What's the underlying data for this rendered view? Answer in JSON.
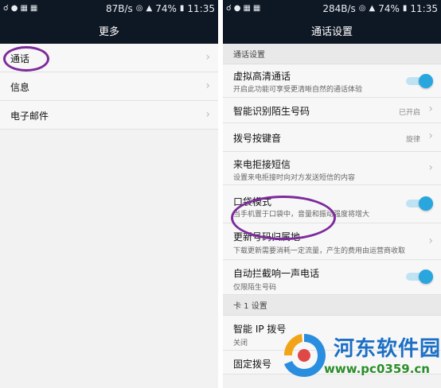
{
  "left": {
    "status": {
      "speed": "87B/s",
      "signal_label": "3G",
      "battery": "74%",
      "time": "11:35"
    },
    "title": "更多",
    "items": [
      {
        "label": "通话"
      },
      {
        "label": "信息"
      },
      {
        "label": "电子邮件"
      }
    ]
  },
  "right": {
    "status": {
      "speed": "284B/s",
      "signal_label": "3G",
      "battery": "74%",
      "time": "11:35"
    },
    "title": "通话设置",
    "sections": {
      "call": "通话设置",
      "card1": "卡 1 设置"
    },
    "rows": {
      "hd": {
        "title": "虚拟高清通话",
        "subtitle": "开启此功能可享受更清晰自然的通话体验",
        "toggle": true
      },
      "stranger": {
        "title": "智能识别陌生号码",
        "value": "已开启"
      },
      "dialtone": {
        "title": "拨号按键音",
        "value": "旋律"
      },
      "reject_sms": {
        "title": "来电拒接短信",
        "subtitle": "设置来电拒接时向对方发送短信的内容"
      },
      "pocket": {
        "title": "口袋模式",
        "subtitle": "当手机置于口袋中，音量和振动强度将增大",
        "toggle": true
      },
      "location": {
        "title": "更新号码归属地",
        "subtitle": "下载更新需要消耗一定流量，产生的费用由运营商收取"
      },
      "block": {
        "title": "自动拦截响一声电话",
        "subtitle": "仅限陌生号码",
        "toggle": true
      },
      "ip": {
        "title": "智能 IP 拨号",
        "subtitle": "关闭"
      },
      "fixed": {
        "title": "固定拨号"
      }
    }
  },
  "watermark": {
    "brand": "河东软件园",
    "url": "www.pc0359.cn"
  },
  "colors": {
    "bar": "#0e1724",
    "toggle_on": "#2aa6df",
    "annotation": "#7d2b9c"
  }
}
